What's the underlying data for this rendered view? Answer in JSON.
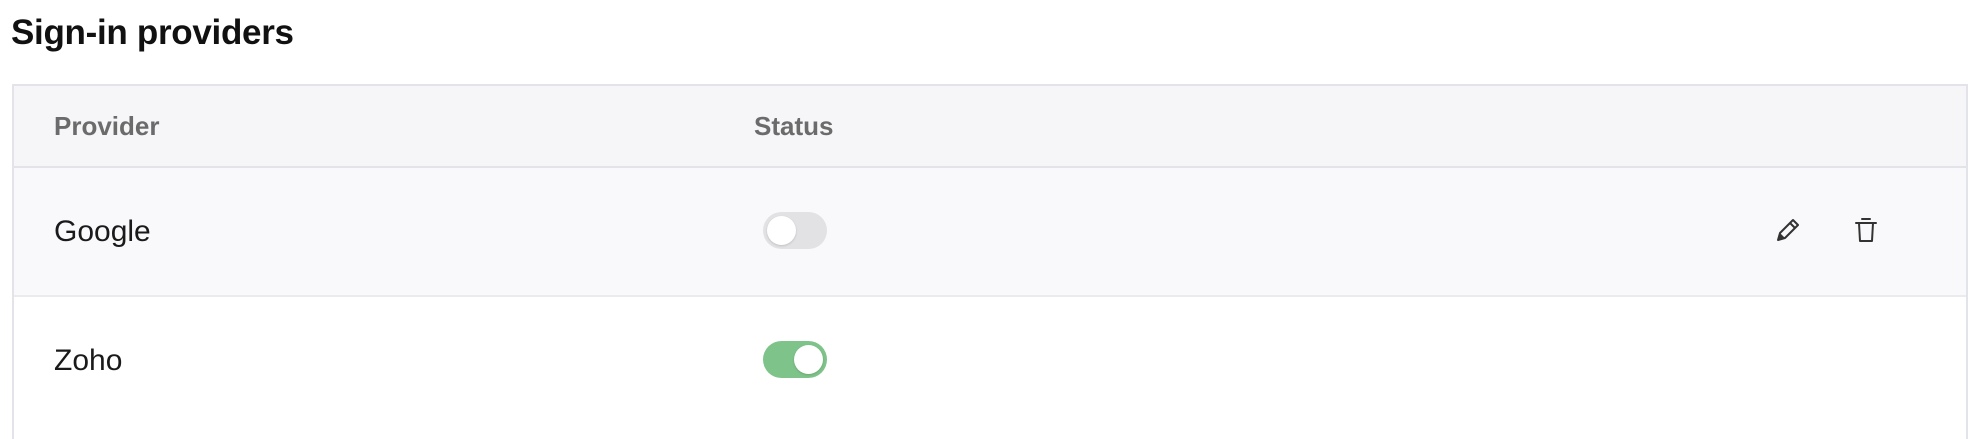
{
  "section": {
    "title": "Sign-in providers"
  },
  "table": {
    "columns": {
      "provider": "Provider",
      "status": "Status"
    },
    "rows": [
      {
        "provider": "Google",
        "enabled": false,
        "actions": [
          "pencil-icon",
          "trash-icon"
        ]
      },
      {
        "provider": "Zoho",
        "enabled": true,
        "actions": []
      }
    ]
  },
  "colors": {
    "toggle_on": "#7ec389",
    "toggle_off": "#e2e2e4",
    "header_bg": "#f6f6f9",
    "border": "#e3e4ea"
  }
}
